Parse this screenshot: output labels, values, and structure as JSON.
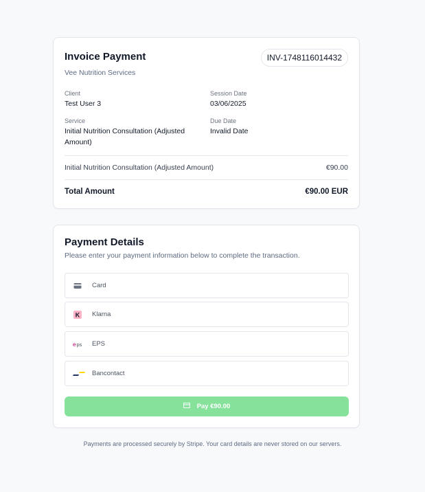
{
  "invoice": {
    "title": "Invoice Payment",
    "provider": "Vee Nutrition Services",
    "invoice_number": "INV-1748116014432",
    "client_label": "Client",
    "client_value": "Test User 3",
    "session_date_label": "Session Date",
    "session_date_value": "03/06/2025",
    "service_label": "Service",
    "service_value": "Initial Nutrition Consultation (Adjusted Amount)",
    "due_date_label": "Due Date",
    "due_date_value": "Invalid Date",
    "line_items": [
      {
        "description": "Initial Nutrition Consultation (Adjusted Amount)",
        "amount": "€90.00"
      }
    ],
    "total_label": "Total Amount",
    "total_value": "€90.00 EUR"
  },
  "payment": {
    "title": "Payment Details",
    "subtitle": "Please enter your payment information below to complete the transaction.",
    "methods": [
      {
        "label": "Card",
        "icon": "card-icon"
      },
      {
        "label": "Klarna",
        "icon": "klarna-icon"
      },
      {
        "label": "EPS",
        "icon": "eps-icon"
      },
      {
        "label": "Bancontact",
        "icon": "bancontact-icon"
      }
    ],
    "pay_button_label": "Pay €90.00",
    "pay_button_color": "#86e29b"
  },
  "footer": {
    "note": "Payments are processed securely by Stripe. Your card details are never stored on our servers."
  },
  "colors": {
    "background": "#f8f9fb",
    "card_border": "#e2e6ec",
    "muted_text": "#5d6b82",
    "klarna_pink": "#ffb3c7",
    "bancontact_blue": "#1e3764",
    "bancontact_yellow": "#ffd800",
    "eps_magenta": "#c8036f"
  }
}
